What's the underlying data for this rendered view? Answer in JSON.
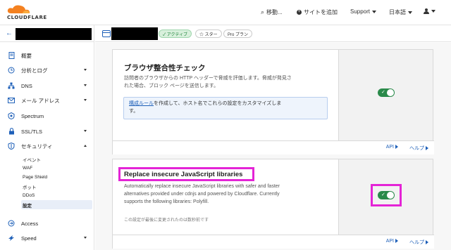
{
  "brand": {
    "name": "CLOUDFLARE",
    "accent": "#f48120"
  },
  "topbar": {
    "go_to": "移動...",
    "add_site": "サイトを追加",
    "support": "Support",
    "language": "日本語"
  },
  "site_header": {
    "status_badge": "✓ アクティブ",
    "star_badge": "☆ スター",
    "plan_badge": "Pro プラン"
  },
  "sidebar": {
    "items": [
      {
        "label": "概要",
        "icon": "document-icon"
      },
      {
        "label": "分析とログ",
        "icon": "clock-icon"
      },
      {
        "label": "DNS",
        "icon": "network-icon"
      },
      {
        "label": "メール アドレス",
        "icon": "mail-icon"
      },
      {
        "label": "Spectrum",
        "icon": "spectrum-icon"
      },
      {
        "label": "SSL/TLS",
        "icon": "lock-icon"
      },
      {
        "label": "セキュリティ",
        "icon": "shield-icon"
      },
      {
        "label": "Access",
        "icon": "access-icon"
      },
      {
        "label": "Speed",
        "icon": "speed-icon"
      }
    ],
    "security_sub": [
      "イベント",
      "WAF",
      "Page Shield",
      "ボット",
      "DDoS",
      "設定"
    ]
  },
  "cards": {
    "browser_check": {
      "title": "ブラウザ整合性チェック",
      "desc_line1": "訪問者のブラウザからの HTTP ヘッダーで脅威を評価します。脅威が発見さ",
      "desc_line2": "れた場合、ブロック ページを送信します。",
      "info_link": "構成ルール",
      "info_text1": "を作成して、ホスト名でこれらの設定をカスタマイズしま",
      "info_text2": "す。",
      "enabled": true,
      "api_link": "API",
      "help_link": "ヘルプ"
    },
    "replace_js": {
      "title": "Replace insecure JavaScript libraries",
      "desc_line1": "Automatically replace insecure JavaScript libraries with safer and faster",
      "desc_line2": "alternatives provided under cdnjs and powered by Cloudflare. Currently",
      "desc_line3": "supports the following libraries: Polyfill.",
      "last_modified": "この設定が最後に変更されたのは数秒前です",
      "enabled": true,
      "api_link": "API",
      "help_link": "ヘルプ"
    }
  }
}
